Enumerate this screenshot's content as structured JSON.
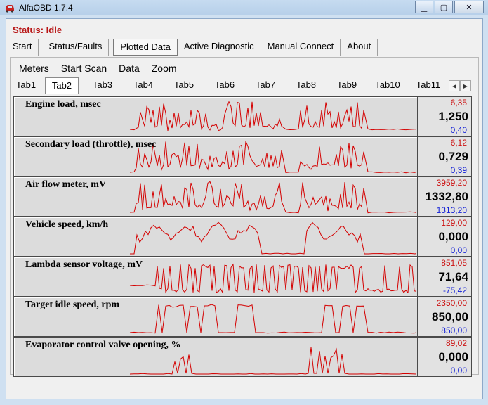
{
  "window": {
    "title": "AlfaOBD 1.7.4",
    "app_icon": "car-icon",
    "minimize_icon": "minimize-icon",
    "maximize_icon": "maximize-icon",
    "close_icon": "close-icon"
  },
  "status": "Status: Idle",
  "main_tabs": [
    "Start",
    "Status/Faults",
    "Plotted Data",
    "Active Diagnostic",
    "Manual Connect",
    "About"
  ],
  "submenu": [
    "Meters",
    "Start Scan",
    "Data",
    "Zoom"
  ],
  "sub_tabs": [
    "Tab1",
    "Tab2",
    "Tab3",
    "Tab4",
    "Tab5",
    "Tab6",
    "Tab7",
    "Tab8",
    "Tab9",
    "Tab10",
    "Tab11"
  ],
  "plots": [
    {
      "label": "Engine load, msec",
      "max": "6,35",
      "current": "1,250",
      "min": "0,40"
    },
    {
      "label": "Secondary load (throttle), msec",
      "max": "6,12",
      "current": "0,729",
      "min": "0,39"
    },
    {
      "label": "Air flow meter, mV",
      "max": "3959,20",
      "current": "1332,80",
      "min": "1313,20"
    },
    {
      "label": "Vehicle speed, km/h",
      "max": "129,00",
      "current": "0,000",
      "min": "0,00"
    },
    {
      "label": "Lambda sensor voltage, mV",
      "max": "851,05",
      "current": "71,64",
      "min": "-75,42"
    },
    {
      "label": "Target idle speed, rpm",
      "max": "2350,00",
      "current": "850,00",
      "min": "850,00"
    },
    {
      "label": "Evaporator control valve opening, %",
      "max": "89,02",
      "current": "0,000",
      "min": "0,00"
    }
  ],
  "colors": {
    "trace": "#d40000",
    "max": "#cc1111",
    "min": "#1421d6",
    "status": "#b81616"
  }
}
